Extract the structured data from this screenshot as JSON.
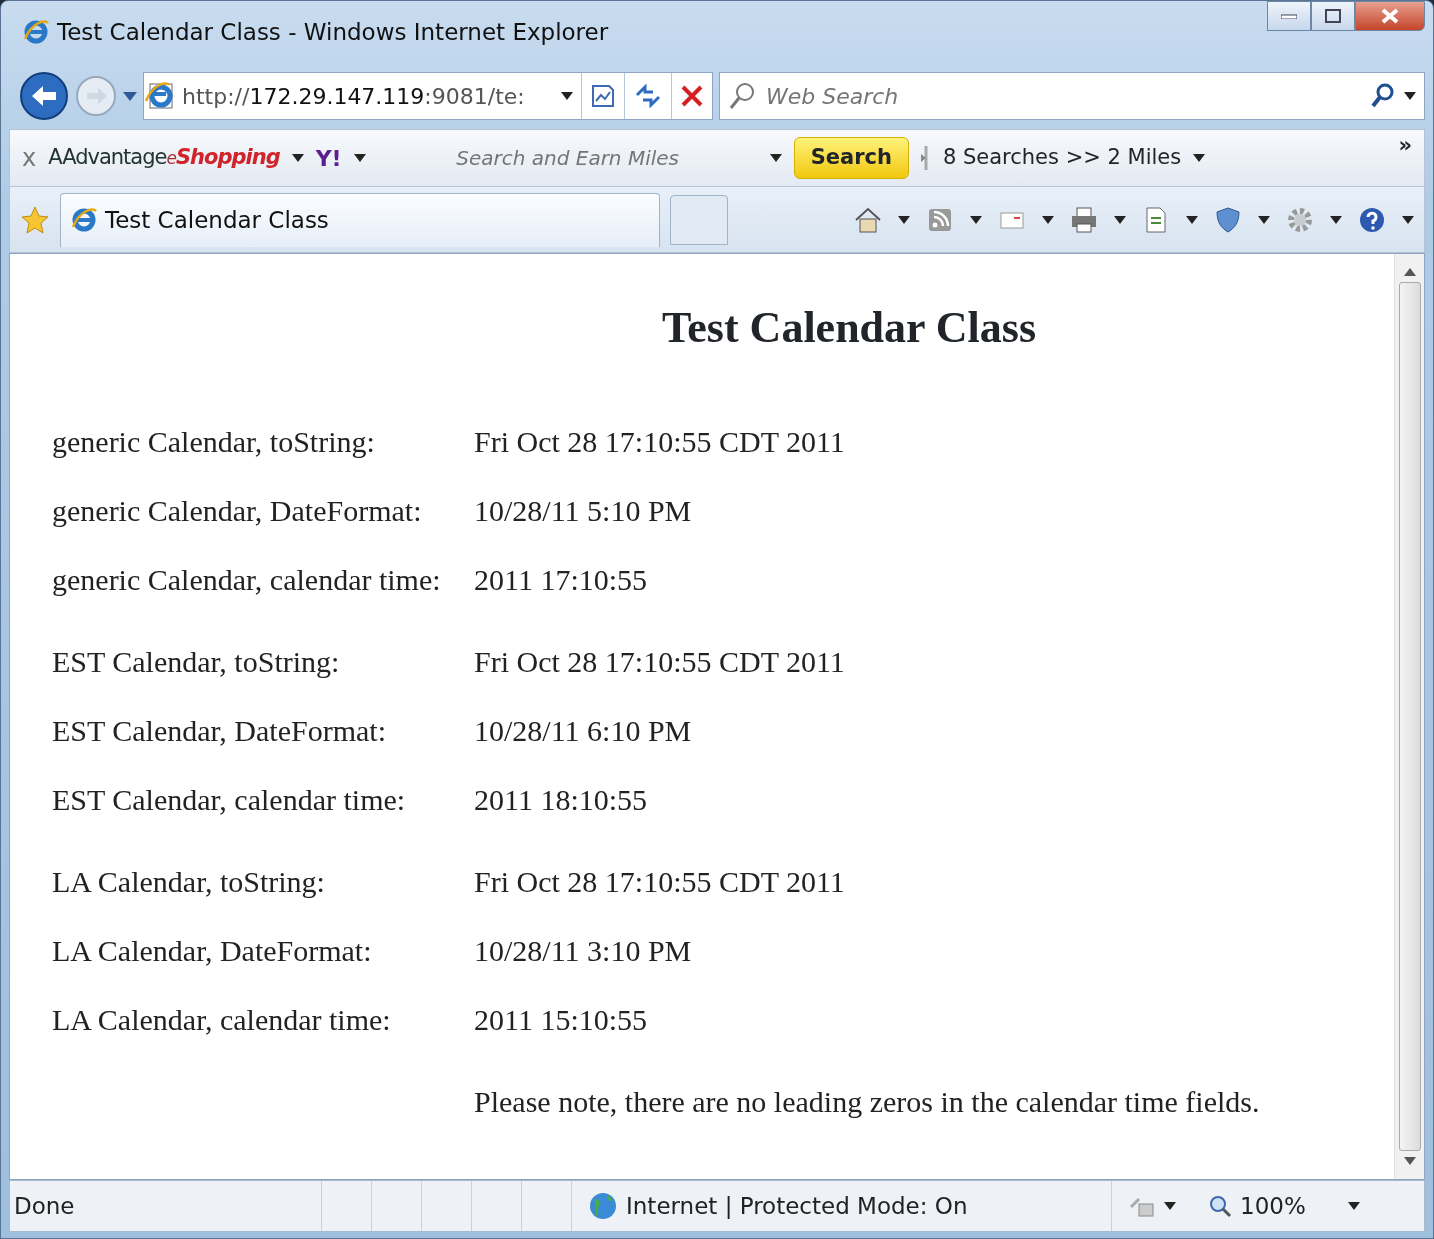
{
  "window": {
    "title": "Test Calendar Class - Windows Internet Explorer"
  },
  "address_bar": {
    "url_prefix": "http://",
    "url_host": "172.29.147.119",
    "url_rest": ":9081/te:",
    "search_placeholder": "Web Search"
  },
  "toolbar": {
    "close": "x",
    "logo_main": "AAdvantage",
    "logo_e": "e",
    "logo_shop": "Shopping",
    "yahoo": "Y!",
    "search_placeholder": "Search and Earn Miles",
    "search_button": "Search",
    "searches": "8 Searches >> 2 Miles",
    "more": "»"
  },
  "tabs": [
    {
      "label": "Test Calendar Class",
      "selected": true
    }
  ],
  "page": {
    "heading": "Test Calendar Class",
    "groups": [
      [
        {
          "label": "generic Calendar, toString:",
          "value": "Fri Oct 28 17:10:55 CDT 2011"
        },
        {
          "label": "generic Calendar, DateFormat:",
          "value": "10/28/11 5:10 PM"
        },
        {
          "label": "generic Calendar, calendar time:",
          "value": "2011 17:10:55"
        }
      ],
      [
        {
          "label": "EST Calendar, toString:",
          "value": "Fri Oct 28 17:10:55 CDT 2011"
        },
        {
          "label": "EST Calendar, DateFormat:",
          "value": "10/28/11 6:10 PM"
        },
        {
          "label": "EST Calendar, calendar time:",
          "value": "2011 18:10:55"
        }
      ],
      [
        {
          "label": "LA Calendar, toString:",
          "value": "Fri Oct 28 17:10:55 CDT 2011"
        },
        {
          "label": "LA Calendar, DateFormat:",
          "value": "10/28/11 3:10 PM"
        },
        {
          "label": "LA Calendar, calendar time:",
          "value": "2011 15:10:55"
        }
      ]
    ],
    "note": "Please note, there are no leading zeros in the calendar time fields."
  },
  "status_bar": {
    "status": "Done",
    "zone": "Internet | Protected Mode: On",
    "zoom": "100%"
  }
}
